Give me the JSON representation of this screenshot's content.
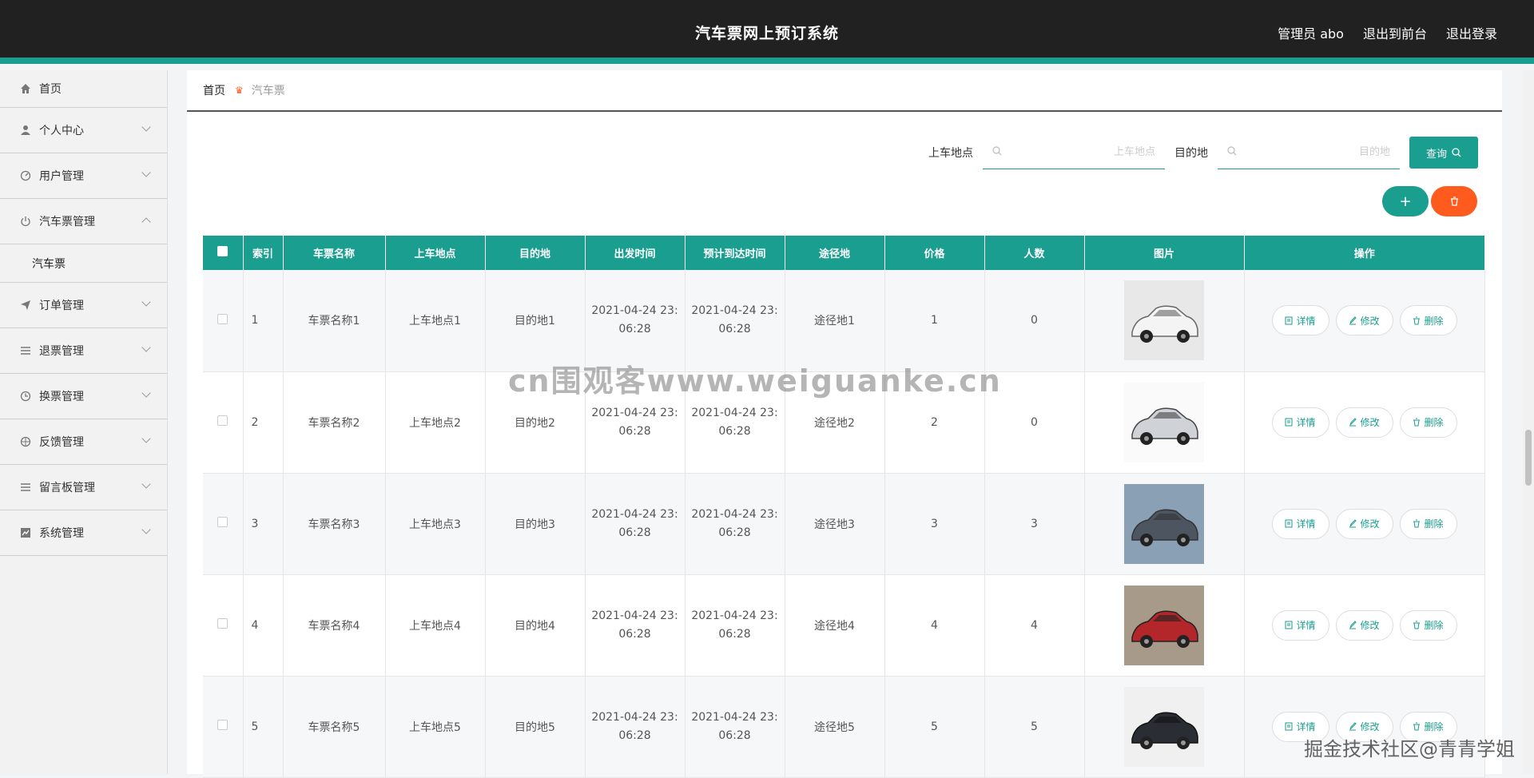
{
  "header": {
    "title": "汽车票网上预订系统",
    "admin_label": "管理员 abo",
    "to_front": "退出到前台",
    "logout": "退出登录"
  },
  "sidebar": {
    "items": [
      {
        "label": "首页",
        "icon": "home-icon"
      },
      {
        "label": "个人中心",
        "icon": "user-icon"
      },
      {
        "label": "用户管理",
        "icon": "gauge-icon"
      },
      {
        "label": "汽车票管理",
        "icon": "power-icon",
        "expanded": true,
        "children": [
          "汽车票"
        ]
      },
      {
        "label": "订单管理",
        "icon": "send-icon"
      },
      {
        "label": "退票管理",
        "icon": "list-icon"
      },
      {
        "label": "换票管理",
        "icon": "clock-icon"
      },
      {
        "label": "反馈管理",
        "icon": "target-icon"
      },
      {
        "label": "留言板管理",
        "icon": "list-icon"
      },
      {
        "label": "系统管理",
        "icon": "chart-icon"
      }
    ]
  },
  "breadcrumb": {
    "home": "首页",
    "current": "汽车票"
  },
  "search": {
    "start_label": "上车地点",
    "start_placeholder": "上车地点",
    "dest_label": "目的地",
    "dest_placeholder": "目的地",
    "query_label": "查询"
  },
  "table": {
    "headers": [
      "",
      "索引",
      "车票名称",
      "上车地点",
      "目的地",
      "出发时间",
      "预计到达时间",
      "途径地",
      "价格",
      "人数",
      "图片",
      "操作"
    ],
    "rows": [
      {
        "index": "1",
        "name": "车票名称1",
        "start": "上车地点1",
        "dest": "目的地1",
        "depart": "2021-04-24 23:",
        "depart2": "06:28",
        "arrive": "2021-04-24 23:",
        "arrive2": "06:28",
        "via": "途径地1",
        "price": "1",
        "people": "0"
      },
      {
        "index": "2",
        "name": "车票名称2",
        "start": "上车地点2",
        "dest": "目的地2",
        "depart": "2021-04-24 23:",
        "depart2": "06:28",
        "arrive": "2021-04-24 23:",
        "arrive2": "06:28",
        "via": "途径地2",
        "price": "2",
        "people": "0"
      },
      {
        "index": "3",
        "name": "车票名称3",
        "start": "上车地点3",
        "dest": "目的地3",
        "depart": "2021-04-24 23:",
        "depart2": "06:28",
        "arrive": "2021-04-24 23:",
        "arrive2": "06:28",
        "via": "途径地3",
        "price": "3",
        "people": "3"
      },
      {
        "index": "4",
        "name": "车票名称4",
        "start": "上车地点4",
        "dest": "目的地4",
        "depart": "2021-04-24 23:",
        "depart2": "06:28",
        "arrive": "2021-04-24 23:",
        "arrive2": "06:28",
        "via": "途径地4",
        "price": "4",
        "people": "4"
      },
      {
        "index": "5",
        "name": "车票名称5",
        "start": "上车地点5",
        "dest": "目的地5",
        "depart": "2021-04-24 23:",
        "depart2": "06:28",
        "arrive": "2021-04-24 23:",
        "arrive2": "06:28",
        "via": "途径地5",
        "price": "5",
        "people": "5"
      }
    ],
    "actions": {
      "detail": "详情",
      "edit": "修改",
      "delete": "删除"
    }
  },
  "watermarks": {
    "center": "cn围观客www.weiguanke.cn",
    "corner": "掘金技术社区@青青学姐"
  },
  "colors": {
    "accent": "#1a9e8f",
    "danger": "#ff5b1f",
    "header_bg": "#212121"
  }
}
